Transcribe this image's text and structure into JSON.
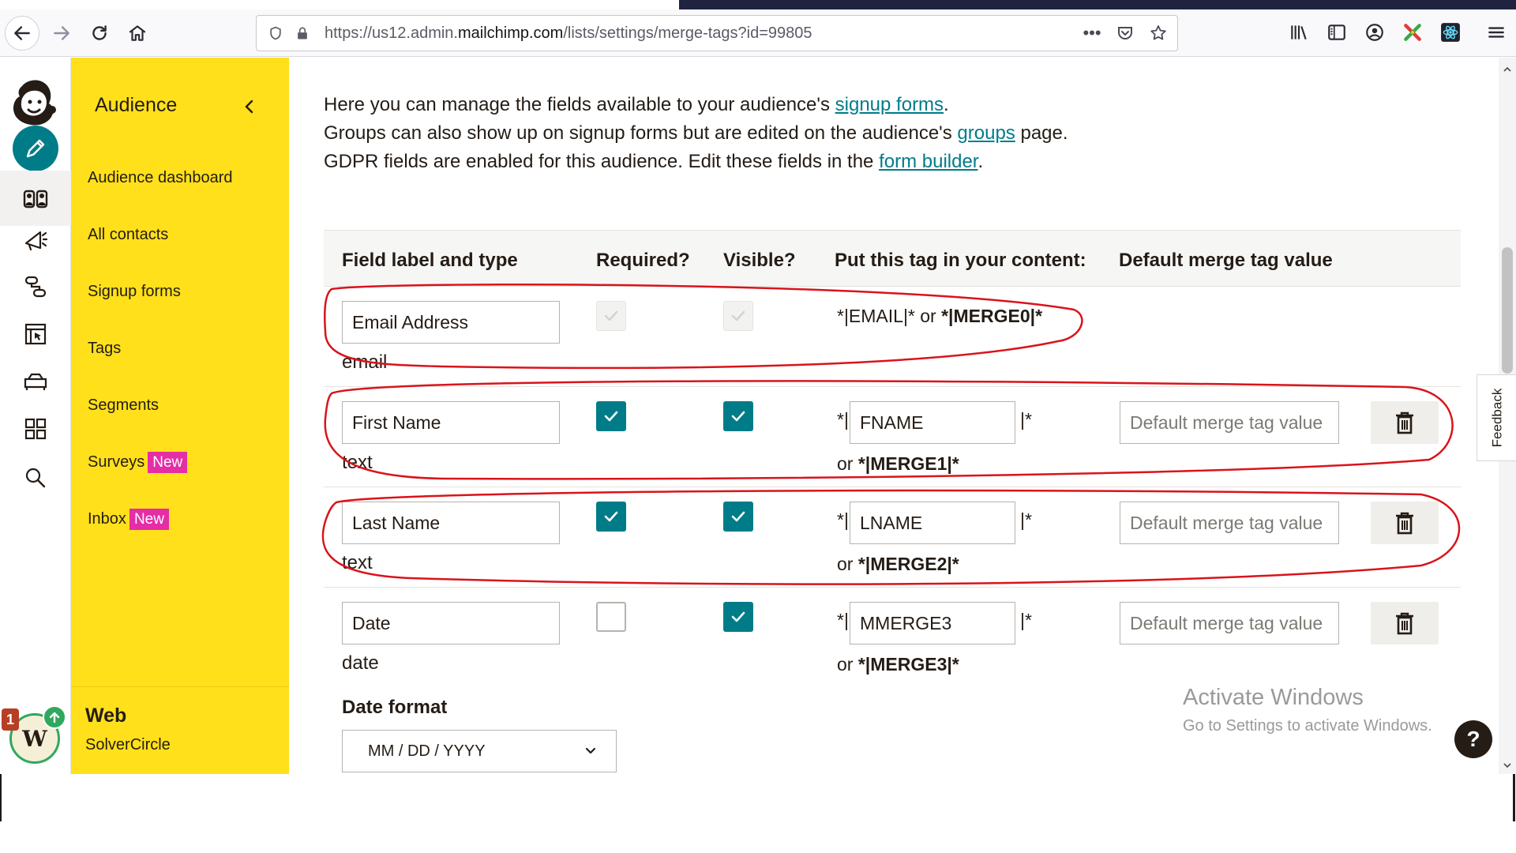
{
  "browser": {
    "url_prefix": "https://us12.admin.",
    "url_host": "mailchimp.com",
    "url_path": "/lists/settings/merge-tags?id=99805",
    "more_icon": "•••"
  },
  "sidenav": {
    "title": "Audience",
    "items": [
      {
        "label": "Audience dashboard",
        "badge": ""
      },
      {
        "label": "All contacts",
        "badge": ""
      },
      {
        "label": "Signup forms",
        "badge": ""
      },
      {
        "label": "Tags",
        "badge": ""
      },
      {
        "label": "Segments",
        "badge": ""
      },
      {
        "label": "Surveys",
        "badge": "New"
      },
      {
        "label": "Inbox",
        "badge": "New"
      }
    ],
    "account_name": "Web",
    "account_sub": "SolverCircle",
    "avatar_letter": "W",
    "notification_count": "1"
  },
  "intro": {
    "line1_text": "Here you can manage the fields available to your audience's ",
    "line1_link": "signup forms",
    "line1_end": ".",
    "line2_text": "Groups can also show up on signup forms but are edited on the audience's ",
    "line2_link": "groups",
    "line2_end": " page.",
    "line3_text": "GDPR fields are enabled for this audience. Edit these fields in the ",
    "line3_link": "form builder",
    "line3_end": "."
  },
  "table": {
    "headers": {
      "field": "Field label and type",
      "required": "Required?",
      "visible": "Visible?",
      "tag": "Put this tag in your content:",
      "default": "Default merge tag value"
    },
    "rows": [
      {
        "label": "Email Address",
        "type": "email",
        "required": true,
        "visible": true,
        "locked": true,
        "tag_static": "*|EMAIL|* or ",
        "tag_static_bold": "*|MERGE0|*"
      },
      {
        "label": "First Name",
        "type": "text",
        "required": true,
        "visible": true,
        "locked": false,
        "tag_prefix": "*|",
        "tag": "FNAME",
        "tag_suffix": "|*",
        "or_text": "or ",
        "merge": "*|MERGE1|*",
        "default_placeholder": "Default merge tag value"
      },
      {
        "label": "Last Name",
        "type": "text",
        "required": true,
        "visible": true,
        "locked": false,
        "tag_prefix": "*|",
        "tag": "LNAME",
        "tag_suffix": "|*",
        "or_text": "or ",
        "merge": "*|MERGE2|*",
        "default_placeholder": "Default merge tag value"
      },
      {
        "label": "Date",
        "type": "date",
        "required": false,
        "visible": true,
        "locked": false,
        "tag_prefix": "*|",
        "tag": "MMERGE3",
        "tag_suffix": "|*",
        "or_text": "or ",
        "merge": "*|MERGE3|*",
        "default_placeholder": "Default merge tag value"
      }
    ],
    "date_format_label": "Date format",
    "date_format_value": "MM / DD / YYYY"
  },
  "feedback_label": "Feedback",
  "watermark": {
    "title": "Activate Windows",
    "subtitle": "Go to Settings to activate Windows."
  },
  "help_label": "?",
  "colors": {
    "brand_yellow": "#ffe01b",
    "accent_teal": "#007c89",
    "new_badge": "#e52da6",
    "annotation_red": "#d9141b"
  }
}
